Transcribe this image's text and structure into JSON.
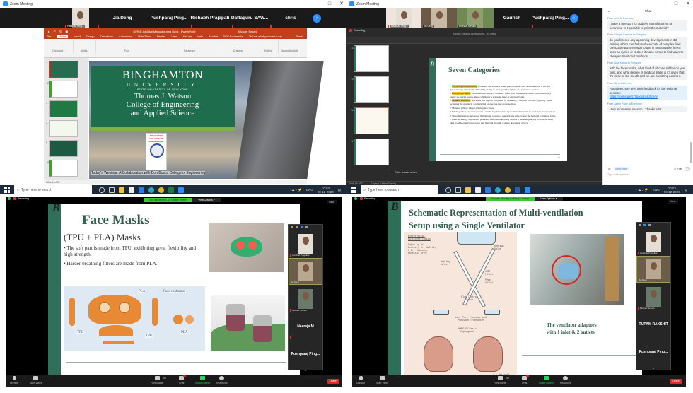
{
  "q1": {
    "window_title": "Zoom Meeting",
    "window_controls": [
      "–",
      "□",
      "✕"
    ],
    "participants_strip": [
      {
        "name": "Harshad Ping...",
        "type": "video"
      },
      {
        "name": "Jia Deng",
        "type": "name"
      },
      {
        "name": "Pushparaj Ping...",
        "type": "name"
      },
      {
        "name": "Rishabh Prajapati",
        "type": "name"
      },
      {
        "name": "Dattaguru SAW...",
        "type": "name"
      },
      {
        "name": "chris",
        "type": "name"
      }
    ],
    "next_label": "›",
    "ppt": {
      "title": "CIRCE Additive Manufacturing Deck - PowerPoint",
      "user": "Michael Sevaro",
      "tabs": [
        "File",
        "Home",
        "Insert",
        "Design",
        "Transitions",
        "Animations",
        "Slide Show",
        "Review",
        "View",
        "Add-ins",
        "Help",
        "Acrobat",
        "PDF Bookmarks",
        "Tell me what you want to do"
      ],
      "share": "Share",
      "ribbon_groups": [
        "Clipboard",
        "Slides",
        "Font",
        "Paragraph",
        "Drawing",
        "Editing",
        "Adobe Acrobat"
      ],
      "slide_count": 6,
      "status": "Slide 1 of 22"
    },
    "slide": {
      "uni_name": "BINGHAMTON",
      "uni_sub": "UNIVERSITY",
      "suny": "STATE UNIVERSITY OF NEW YORK",
      "college_lines": [
        "Thomas J. Watson",
        "College of Engineering",
        "and Applied Science"
      ],
      "logo_text": "DON BOSCO COLLEGE OF ENGINEERING",
      "caption": "Today's Webinar: A Collaboration with Don Bosco College of Engineering"
    },
    "taskbar": {
      "search_placeholder": "Type here to search",
      "lang": "ENG",
      "time": "10:03",
      "date": "08-12-2020"
    }
  },
  "q2": {
    "window_title": "Zoom Meeting",
    "recording": "Recording",
    "participants_strip": [
      {
        "name": "Harshad Ping...",
        "type": "video"
      },
      {
        "name": "Jia Deng",
        "type": "video"
      },
      {
        "name": "Michael Sevaro",
        "type": "video"
      },
      {
        "name": "Gaurish",
        "type": "name"
      },
      {
        "name": "Pushparaj Ping...",
        "type": "name"
      }
    ],
    "shared_window": "Add for Medical Applications - Jia Deng",
    "slide_numbers": [
      "14",
      "15",
      "16",
      "17"
    ],
    "notes_placeholder": "Click to add notes",
    "status_left": "Slide 16 of 22",
    "status_lang": "English (United States)",
    "slide": {
      "title": "Seven Categories",
      "bullets": [
        {
          "hl": "Vat photopolymerization",
          "text": ": processes that utilize a liquid photopolymer that is contained in a vat and processed by selectively delivering energy to cure specific regions of a part cross-section."
        },
        {
          "hl": "Powder bed fusion",
          "text": ": processes that utilize a container filled with powder that is processed selectively using an energy source, most commonly a scanning laser or electron beam."
        },
        {
          "hl": "Material extrusion",
          "text": ": processes that deposit a material by extruding it through a nozzle, typically while scanning the nozzle in a pattern that produces a part cross-section."
        },
        {
          "hl": "",
          "text": "Material jetting: ink-jet printing processes"
        },
        {
          "hl": "",
          "text": "Binder jetting: processes where a binder is printed into a powder bed in order to form part cross-sections."
        },
        {
          "hl": "",
          "text": "Sheet lamination: processes that deposit a layer of material at a time, where the material is in sheet form."
        },
        {
          "hl": "",
          "text": "Directed energy deposition: processes that simultaneously deposit a material (usually powder or wire) and provide energy to process that material through a single deposition device."
        }
      ],
      "page_num": "16"
    },
    "chat": {
      "title": "Chat",
      "messages": [
        {
          "from": "chris",
          "to": "Everyone",
          "text": "I have a question for additive manufacturing for ceramics. Is it possible to print the material?",
          "style": "grey"
        },
        {
          "from": "Sinapsi Saptarsi",
          "to": "Everyone",
          "text": "do you foresee any upcoming developments in 3d printing which can help reduce costs of complex fiber composite parts enough to use in mass market items such as cycles or is does it make sense to find ways to cheapen traditional methods",
          "style": "grey"
        },
        {
          "from": "Nisa Kalbar",
          "to": "Everyone",
          "text": "with the face masks, what kind of silicone rubber do you print, and what degree of medical grade is it? given that it's close to the mouth and we are breathing next to it",
          "style": "grey"
        },
        {
          "from": "Me",
          "to": "Everyone",
          "text": "Attendees may give their feedback for the webinar session:",
          "link": "https://forms.gle/zr7poon2A8J5mAA",
          "style": "blue"
        },
        {
          "from": "Akash Rane",
          "to": "Everyone",
          "text": "Very informative session.. Thanks a lot.",
          "style": "grey"
        }
      ],
      "to_label": "To:",
      "to_value": "Everyone",
      "file_label": "File",
      "more_label": "···",
      "placeholder": "Type message here..."
    },
    "taskbar": {
      "search_placeholder": "Type here to search",
      "lang": "ENG",
      "time": "20:03",
      "date": "08-12-2020"
    }
  },
  "q3": {
    "recording": "Recording",
    "viewing_banner": "You are viewing Jia Deng's screen",
    "view_options": "View Options ▾",
    "view_btn": "View",
    "slide": {
      "title": "Face Masks",
      "subtitle": "(TPU + PLA) Masks",
      "bullets": [
        "The soft part  is made from TPU, exhibiting great flexibility and high strength.",
        "Harder breathing filters are made from PLA."
      ],
      "labels": [
        "PLA",
        "Face conformal",
        "TPU",
        "TPU",
        "PLA"
      ]
    },
    "gallery": [
      {
        "name": "Harshad Pingulkar",
        "type": "video"
      },
      {
        "name": "Jia Deng",
        "type": "video"
      },
      {
        "name": "Michael Sevaro",
        "type": "video"
      },
      {
        "name": "Neeraja M",
        "type": "name"
      },
      {
        "name": "Pushparaj Ping...",
        "type": "name"
      }
    ],
    "toolbar": {
      "unmute": "Unmute",
      "start_video": "Start Video",
      "participants": "Participants",
      "participants_count": "58",
      "chat": "Chat",
      "share": "Share Screen",
      "reactions": "Reactions",
      "leave": "Leave"
    }
  },
  "q4": {
    "recording": "Recording",
    "viewing_banner": "You are viewing Jia Deng's screen",
    "view_options": "View Options ▾",
    "view_btn": "View",
    "slide": {
      "title_line1": "Schematic Representation of  Multi-ventilation",
      "title_line2": "Setup using a Single Ventilator",
      "diagram_heading": "Differential Multiventilation",
      "diagram_setup": "Setup by Dr. Beitler, Dr. Kallet, & Dr. Jabbour, Hospital Grel.",
      "diagram_labels": [
        "One-Way Valve",
        "One-Way Valve",
        "HMEF Filter",
        "Peep Valve*",
        "Flow Control Valve",
        "Luer Port Pressure and Pressure Transducer",
        "HMEF Filter + Capnogram*",
        "* = Optional"
      ],
      "caption_line1": "The ventilator adaptors",
      "caption_line2": "with 1 inlet & 2 outlets"
    },
    "gallery": [
      {
        "name": "Harshad Pingulkar",
        "type": "video"
      },
      {
        "name": "Jia Deng",
        "type": "video"
      },
      {
        "name": "Michael Sevaro",
        "type": "video"
      },
      {
        "name": "RUPAM RAKSHIT",
        "type": "name"
      },
      {
        "name": "Pushparaj Ping...",
        "type": "name"
      }
    ],
    "toolbar": {
      "unmute": "Unmute",
      "start_video": "Start Video",
      "participants": "Participants",
      "participants_count": "58",
      "chat": "Chat",
      "share": "Share Screen",
      "reactions": "Reactions",
      "leave": "Leave"
    }
  }
}
